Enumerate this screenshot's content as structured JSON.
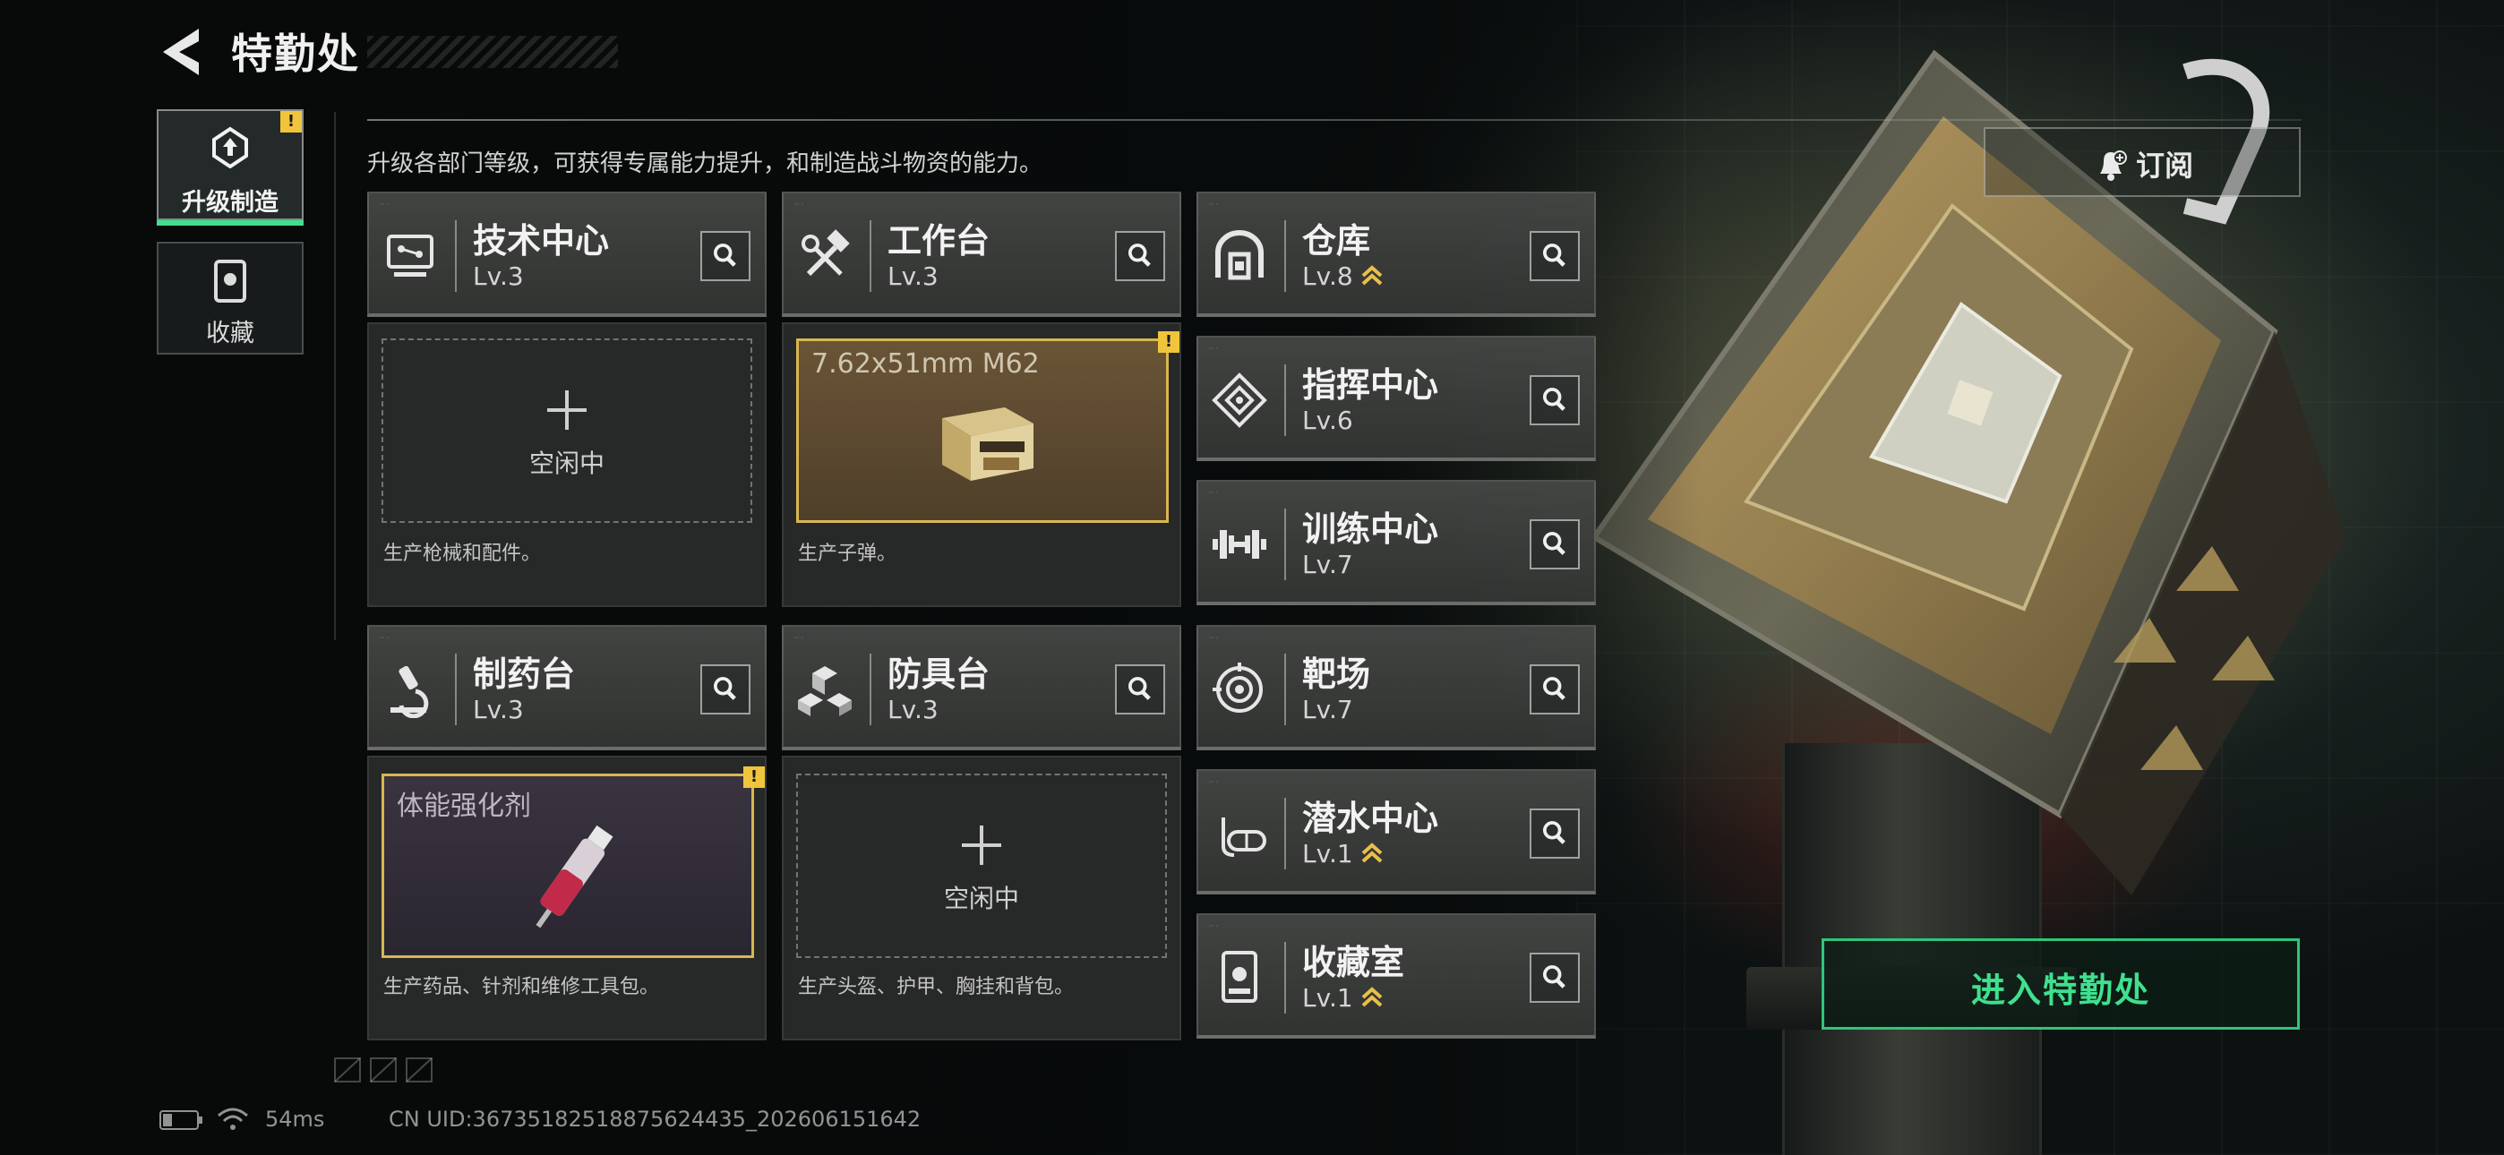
{
  "header": {
    "title": "特勤处",
    "subtitle": "升级各部门等级，可获得专属能力提升，和制造战斗物资的能力。"
  },
  "side_tabs": [
    {
      "label": "升级制造",
      "active": true,
      "alert": "!"
    },
    {
      "label": "收藏",
      "active": false
    }
  ],
  "cards": [
    {
      "name": "技术中心",
      "level": "Lv.3",
      "slot": {
        "type": "empty",
        "label": "空闲中"
      },
      "desc": "生产枪械和配件。"
    },
    {
      "name": "工作台",
      "level": "Lv.3",
      "slot": {
        "type": "item",
        "item_name": "7.62x51mm M62",
        "alert": "!"
      },
      "desc": "生产子弹。"
    },
    {
      "name": "制药台",
      "level": "Lv.3",
      "slot": {
        "type": "item",
        "item_name": "体能强化剂",
        "alert": "!"
      },
      "desc": "生产药品、针剂和维修工具包。"
    },
    {
      "name": "防具台",
      "level": "Lv.3",
      "slot": {
        "type": "empty",
        "label": "空闲中"
      },
      "desc": "生产头盔、护甲、胸挂和背包。"
    }
  ],
  "facilities": [
    {
      "name": "仓库",
      "level": "Lv.8",
      "upgradable": true
    },
    {
      "name": "指挥中心",
      "level": "Lv.6",
      "upgradable": false
    },
    {
      "name": "训练中心",
      "level": "Lv.7",
      "upgradable": false
    },
    {
      "name": "靶场",
      "level": "Lv.7",
      "upgradable": false
    },
    {
      "name": "潜水中心",
      "level": "Lv.1",
      "upgradable": true
    },
    {
      "name": "收藏室",
      "level": "Lv.1",
      "upgradable": true
    }
  ],
  "buttons": {
    "subscribe": "订阅",
    "enter": "进入特勤处"
  },
  "footer": {
    "ping": "54ms",
    "uid": "CN UID:3673518251887562443‌5_202606151642"
  },
  "colors": {
    "accent_green": "#3fe08e",
    "alert_yellow": "#f0c53c",
    "upgrade_gold": "#e8c04a"
  },
  "icons": {
    "back": "back-arrow-icon",
    "upgrade_tab": "upgrade-gear-icon",
    "collect_tab": "trophy-case-icon",
    "search": "magnifier-icon",
    "bell": "bell-plus-icon",
    "battery": "battery-icon",
    "wifi": "wifi-icon"
  }
}
